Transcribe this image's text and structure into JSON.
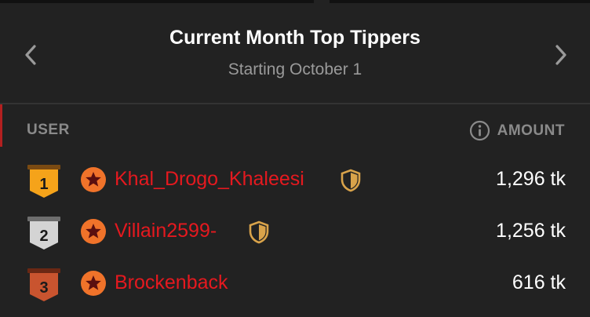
{
  "header": {
    "title": "Current Month Top Tippers",
    "subtitle": "Starting October 1"
  },
  "columns": {
    "user": "USER",
    "amount": "AMOUNT"
  },
  "rows": [
    {
      "rank": "1",
      "username": "Khal_Drogo_Khaleesi",
      "amount": "1,296 tk",
      "badge_color": "#f5a31a",
      "has_shield": true
    },
    {
      "rank": "2",
      "username": "Villain2599-",
      "amount": "1,256 tk",
      "badge_color": "#d4d4d4",
      "has_shield": true
    },
    {
      "rank": "3",
      "username": "Brockenback",
      "amount": "616 tk",
      "badge_color": "#c9542f",
      "has_shield": false
    }
  ],
  "colors": {
    "username": "#e5191f",
    "user_icon": "#f0732a",
    "shield": "#d9a34a"
  },
  "icons": [
    "chevron-left-icon",
    "chevron-right-icon",
    "info-icon",
    "rank-badge-icon",
    "user-star-icon",
    "shield-icon"
  ]
}
